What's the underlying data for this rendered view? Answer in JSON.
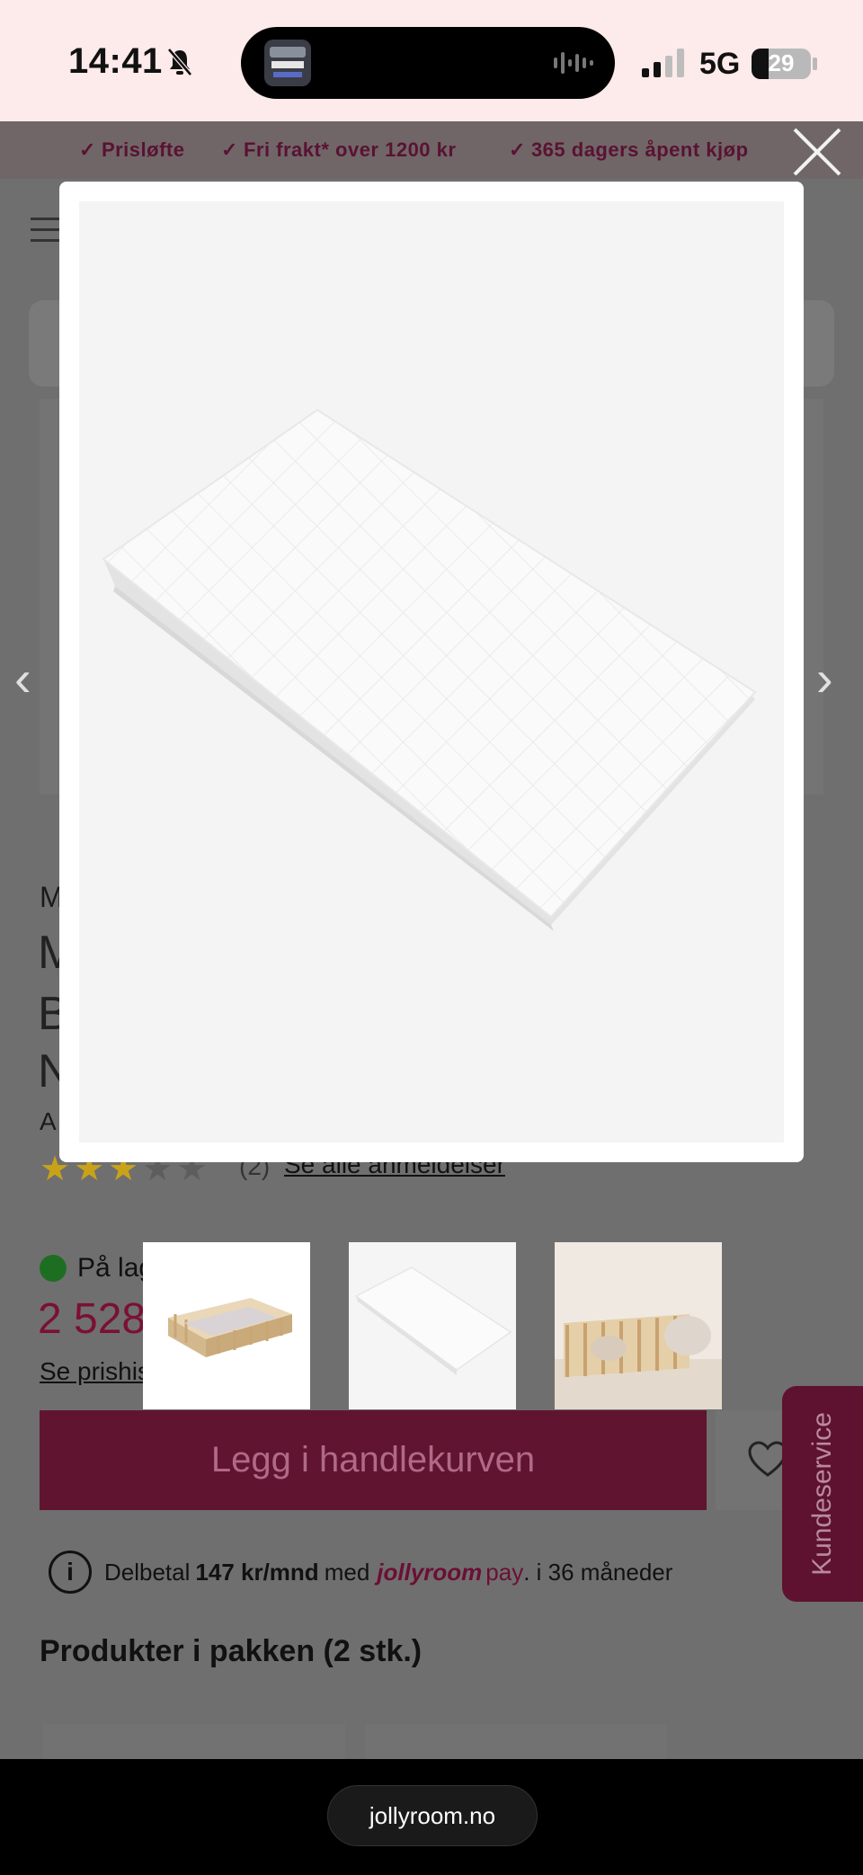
{
  "status_bar": {
    "time": "14:41",
    "network": "5G",
    "battery": "29",
    "battery_level": 0.29,
    "icons": [
      "bell-slash-icon",
      "waveform-icon",
      "signal-icon",
      "battery-icon"
    ]
  },
  "promo_bar": {
    "items": [
      "Prisløfte",
      "Fri frakt* over 1200 kr",
      "365 dagers åpent kjøp"
    ]
  },
  "background_page": {
    "brand_initial": "M",
    "title_lines": [
      "M",
      "B",
      "N"
    ],
    "article_initial": "A",
    "rating": {
      "stars_filled": 3,
      "stars_total": 5,
      "count": "(2)",
      "link": "Se alle anmeldelser"
    },
    "stock": "På lag",
    "price": "2 528",
    "price_history": "Se prishis",
    "add_to_cart": "Legg i handlekurven",
    "installment": {
      "prefix": "Delbetal",
      "amount": "147 kr/mnd",
      "middle": "med",
      "brand": "jollyroom",
      "brand_suffix": "pay",
      "suffix": ". i 36 måneder"
    },
    "bundle_title": "Produkter i pakken (2 stk.)",
    "customer_service": "Kundeservice"
  },
  "lightbox": {
    "image_subject": "quilted-white-mattress",
    "thumbnails": [
      "wooden-floor-bed",
      "white-mattress",
      "bed-in-room"
    ],
    "selected_thumbnail": 1
  },
  "browser": {
    "url": "jollyroom.no"
  },
  "colors": {
    "brand": "#6b0f34",
    "promo_text": "#5a1233",
    "star": "#c9a21a",
    "stock": "#1e6e22"
  }
}
